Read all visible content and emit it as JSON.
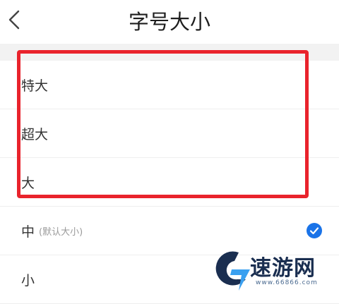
{
  "header": {
    "title": "字号大小"
  },
  "options": [
    {
      "label": "特大",
      "hint": "",
      "selected": false
    },
    {
      "label": "超大",
      "hint": "",
      "selected": false
    },
    {
      "label": "大",
      "hint": "",
      "selected": false
    },
    {
      "label": "中",
      "hint": "(默认大小)",
      "selected": true
    },
    {
      "label": "小",
      "hint": "",
      "selected": false
    }
  ],
  "watermark": {
    "brand": "速游网",
    "url": "www.66866.com"
  },
  "colors": {
    "accent": "#1a73e8",
    "highlight": "#e9232c",
    "divider": "#eeeeee"
  },
  "icons": {
    "back": "chevron-left-icon",
    "selected": "check-circle-icon",
    "logo": "logo-icon"
  }
}
